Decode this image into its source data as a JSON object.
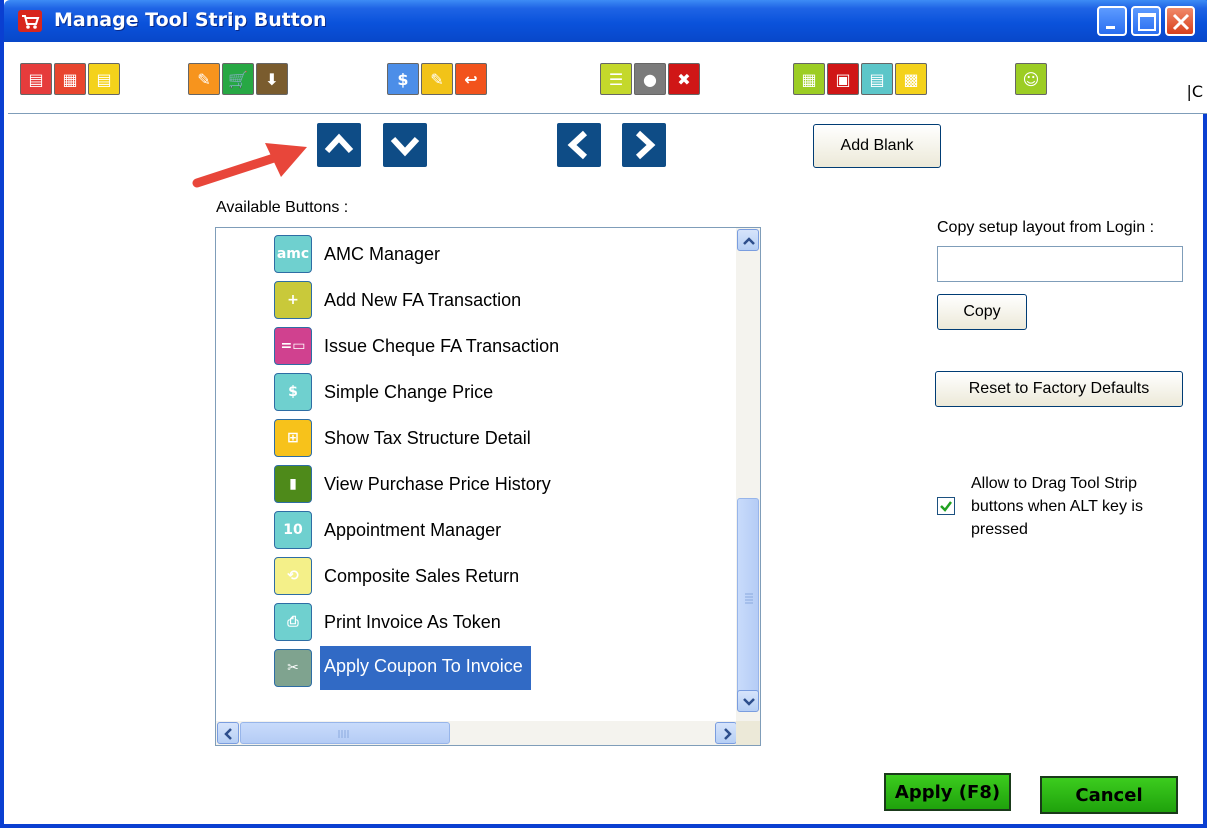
{
  "window": {
    "title": "Manage Tool Strip Button",
    "icon": "cart-icon"
  },
  "toolbar": {
    "overflow_text": "|C",
    "icons": [
      {
        "name": "invoice-icon",
        "bg": "#e63c3c",
        "glyph": "▤"
      },
      {
        "name": "invoice-list-icon",
        "bg": "#e8452e",
        "glyph": "▦"
      },
      {
        "name": "invoice-export-icon",
        "bg": "#f4d21b",
        "glyph": "▤"
      },
      {
        "name": "edit-document-icon",
        "bg": "#f7941d",
        "glyph": "✎"
      },
      {
        "name": "shopping-cart-icon",
        "bg": "#27a844",
        "glyph": "🛒"
      },
      {
        "name": "import-icon",
        "bg": "#7a5c2e",
        "glyph": "⬇"
      },
      {
        "name": "change-price-icon",
        "bg": "#4c8ee8",
        "glyph": "$"
      },
      {
        "name": "notes-edit-icon",
        "bg": "#f2c318",
        "glyph": "✎"
      },
      {
        "name": "return-icon",
        "bg": "#f2531c",
        "glyph": "↩"
      },
      {
        "name": "checklist-icon",
        "bg": "#c4d82b",
        "glyph": "☰"
      },
      {
        "name": "amc-icon",
        "bg": "#7b7b7b",
        "glyph": "●"
      },
      {
        "name": "cancel-icon",
        "bg": "#d01616",
        "glyph": "✖"
      },
      {
        "name": "calculator-icon",
        "bg": "#9ccd24",
        "glyph": "▦"
      },
      {
        "name": "tax-icon",
        "bg": "#d01616",
        "glyph": "▣"
      },
      {
        "name": "pos-calculator-icon",
        "bg": "#5cc6c9",
        "glyph": "▤"
      },
      {
        "name": "grid-colors-icon",
        "bg": "#f4d21b",
        "glyph": "▩"
      },
      {
        "name": "user-icon",
        "bg": "#9ccd24",
        "glyph": "☺"
      }
    ]
  },
  "nav": {
    "up_icon": "move-up-icon",
    "down_icon": "move-down-icon",
    "left_icon": "move-left-icon",
    "right_icon": "move-right-icon"
  },
  "buttons": {
    "add_blank": "Add Blank",
    "copy": "Copy",
    "reset": "Reset to Factory Defaults",
    "apply": "Apply (F8)",
    "cancel": "Cancel"
  },
  "available_label": "Available  Buttons :",
  "available_buttons": [
    {
      "label": "AMC Manager",
      "icon": "amc-icon",
      "bg": "#6fd0cf",
      "glyph": "amc",
      "selected": false
    },
    {
      "label": "Add New FA Transaction",
      "icon": "add-fa-transaction-icon",
      "bg": "#c9c93a",
      "glyph": "+",
      "selected": false
    },
    {
      "label": "Issue Cheque FA Transaction",
      "icon": "cheque-icon",
      "bg": "#d0418f",
      "glyph": "=▭",
      "selected": false
    },
    {
      "label": "Simple Change Price",
      "icon": "change-price-icon",
      "bg": "#6fd0cf",
      "glyph": "$",
      "selected": false
    },
    {
      "label": "Show Tax Structure Detail",
      "icon": "tax-structure-icon",
      "bg": "#f7c21b",
      "glyph": "⊞",
      "selected": false
    },
    {
      "label": "View Purchase Price History",
      "icon": "price-history-icon",
      "bg": "#4e8a1a",
      "glyph": "▮",
      "selected": false
    },
    {
      "label": "Appointment Manager",
      "icon": "calendar-icon",
      "bg": "#6fd0cf",
      "glyph": "10",
      "selected": false
    },
    {
      "label": "Composite Sales Return",
      "icon": "composite-return-icon",
      "bg": "#f4f089",
      "glyph": "⟲",
      "selected": false
    },
    {
      "label": "Print Invoice As Token",
      "icon": "print-token-icon",
      "bg": "#6fd0cf",
      "glyph": "⎙",
      "selected": false
    },
    {
      "label": "Apply Coupon To Invoice",
      "icon": "coupon-icon",
      "bg": "#7fa38f",
      "glyph": "✂",
      "selected": true
    }
  ],
  "copy_section": {
    "label": "Copy setup layout from Login :",
    "value": ""
  },
  "drag_option": {
    "label_lines": [
      "Allow to Drag Tool Strip",
      "buttons when ALT key is",
      "pressed"
    ],
    "checked": true
  }
}
